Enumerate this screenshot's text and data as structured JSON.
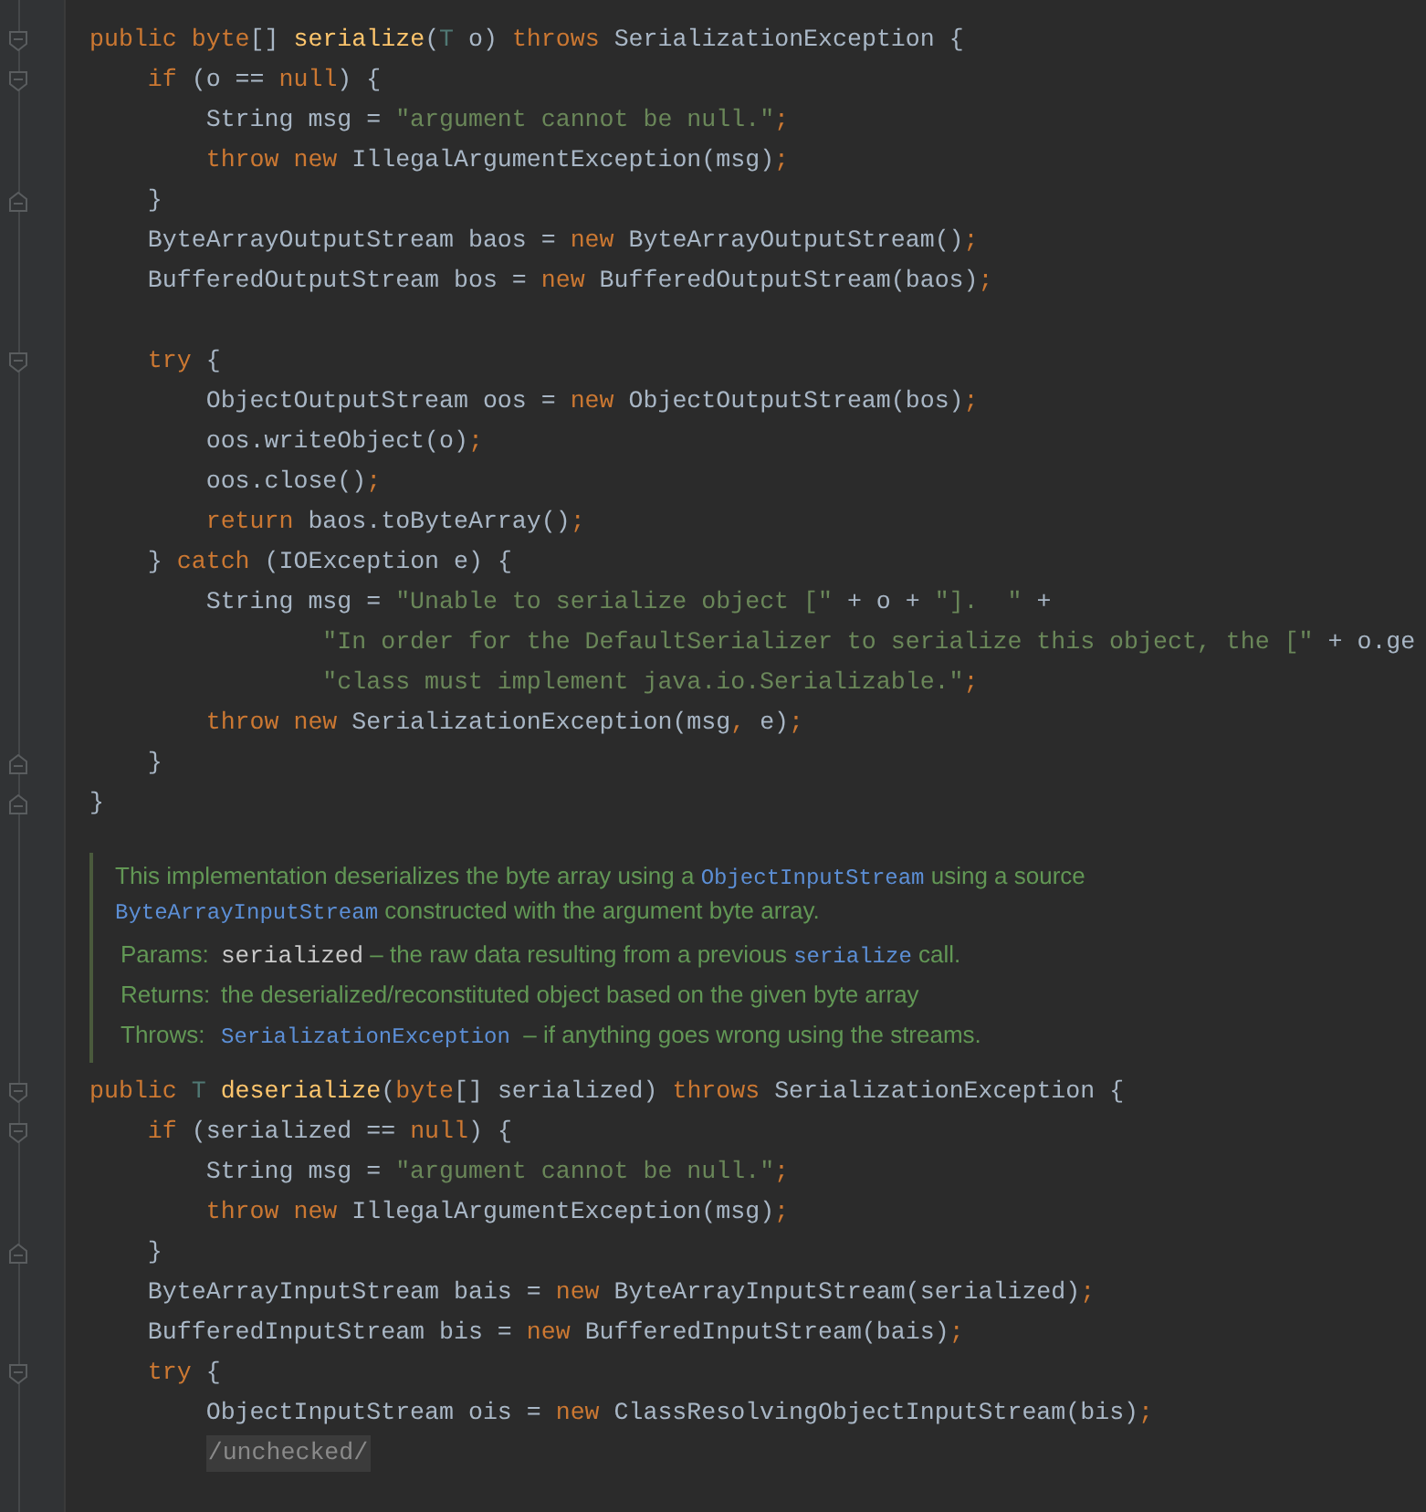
{
  "code_top": [
    {
      "kind": "fold-start",
      "tokens": [
        {
          "color": "#cc7832",
          "t": "public byte"
        },
        {
          "color": "#a9b7c6",
          "t": "[] "
        },
        {
          "color": "#ffc66d",
          "t": "serialize"
        },
        {
          "color": "#a9b7c6",
          "t": "("
        },
        {
          "color": "#507874",
          "t": "T"
        },
        {
          "color": "#a9b7c6",
          "t": " o) "
        },
        {
          "color": "#cc7832",
          "t": "throws "
        },
        {
          "color": "#a9b7c6",
          "t": "SerializationException {"
        }
      ]
    },
    {
      "kind": "fold-start",
      "tokens": [
        {
          "color": "#cc7832",
          "t": "    if "
        },
        {
          "color": "#a9b7c6",
          "t": "(o == "
        },
        {
          "color": "#cc7832",
          "t": "null"
        },
        {
          "color": "#a9b7c6",
          "t": ") {"
        }
      ]
    },
    {
      "kind": "plain",
      "tokens": [
        {
          "color": "#a9b7c6",
          "t": "        String msg = "
        },
        {
          "color": "#6a8759",
          "t": "\"argument cannot be null.\""
        },
        {
          "color": "#cc7832",
          "t": ";"
        }
      ]
    },
    {
      "kind": "plain",
      "tokens": [
        {
          "color": "#cc7832",
          "t": "        throw new "
        },
        {
          "color": "#a9b7c6",
          "t": "IllegalArgumentException(msg)"
        },
        {
          "color": "#cc7832",
          "t": ";"
        }
      ]
    },
    {
      "kind": "fold-end",
      "tokens": [
        {
          "color": "#a9b7c6",
          "t": "    }"
        }
      ]
    },
    {
      "kind": "plain",
      "tokens": [
        {
          "color": "#a9b7c6",
          "t": "    ByteArrayOutputStream baos = "
        },
        {
          "color": "#cc7832",
          "t": "new "
        },
        {
          "color": "#a9b7c6",
          "t": "ByteArrayOutputStream()"
        },
        {
          "color": "#cc7832",
          "t": ";"
        }
      ]
    },
    {
      "kind": "plain",
      "tokens": [
        {
          "color": "#a9b7c6",
          "t": "    BufferedOutputStream bos = "
        },
        {
          "color": "#cc7832",
          "t": "new "
        },
        {
          "color": "#a9b7c6",
          "t": "BufferedOutputStream(baos)"
        },
        {
          "color": "#cc7832",
          "t": ";"
        }
      ]
    },
    {
      "kind": "blank"
    },
    {
      "kind": "fold-start",
      "tokens": [
        {
          "color": "#cc7832",
          "t": "    try "
        },
        {
          "color": "#a9b7c6",
          "t": "{"
        }
      ]
    },
    {
      "kind": "plain",
      "tokens": [
        {
          "color": "#a9b7c6",
          "t": "        ObjectOutputStream oos = "
        },
        {
          "color": "#cc7832",
          "t": "new "
        },
        {
          "color": "#a9b7c6",
          "t": "ObjectOutputStream(bos)"
        },
        {
          "color": "#cc7832",
          "t": ";"
        }
      ]
    },
    {
      "kind": "plain",
      "tokens": [
        {
          "color": "#a9b7c6",
          "t": "        oos.writeObject(o)"
        },
        {
          "color": "#cc7832",
          "t": ";"
        }
      ]
    },
    {
      "kind": "plain",
      "tokens": [
        {
          "color": "#a9b7c6",
          "t": "        oos.close()"
        },
        {
          "color": "#cc7832",
          "t": ";"
        }
      ]
    },
    {
      "kind": "plain",
      "tokens": [
        {
          "color": "#cc7832",
          "t": "        return "
        },
        {
          "color": "#a9b7c6",
          "t": "baos.toByteArray()"
        },
        {
          "color": "#cc7832",
          "t": ";"
        }
      ]
    },
    {
      "kind": "plain",
      "tokens": [
        {
          "color": "#a9b7c6",
          "t": "    } "
        },
        {
          "color": "#cc7832",
          "t": "catch "
        },
        {
          "color": "#a9b7c6",
          "t": "(IOException e) {"
        }
      ]
    },
    {
      "kind": "plain",
      "tokens": [
        {
          "color": "#a9b7c6",
          "t": "        String msg = "
        },
        {
          "color": "#6a8759",
          "t": "\"Unable to serialize object [\" "
        },
        {
          "color": "#a9b7c6",
          "t": "+ o + "
        },
        {
          "color": "#6a8759",
          "t": "\"].  \" "
        },
        {
          "color": "#a9b7c6",
          "t": "+"
        }
      ]
    },
    {
      "kind": "plain",
      "tokens": [
        {
          "color": "#6a8759",
          "t": "                \"In order for the DefaultSerializer to serialize this object, the [\" "
        },
        {
          "color": "#a9b7c6",
          "t": "+ o.ge"
        }
      ]
    },
    {
      "kind": "plain",
      "tokens": [
        {
          "color": "#6a8759",
          "t": "                \"class must implement java.io.Serializable.\""
        },
        {
          "color": "#cc7832",
          "t": ";"
        }
      ]
    },
    {
      "kind": "plain",
      "tokens": [
        {
          "color": "#cc7832",
          "t": "        throw new "
        },
        {
          "color": "#a9b7c6",
          "t": "SerializationException(msg"
        },
        {
          "color": "#cc7832",
          "t": ", "
        },
        {
          "color": "#a9b7c6",
          "t": "e)"
        },
        {
          "color": "#cc7832",
          "t": ";"
        }
      ]
    },
    {
      "kind": "fold-end",
      "tokens": [
        {
          "color": "#a9b7c6",
          "t": "    }"
        }
      ]
    },
    {
      "kind": "fold-end",
      "tokens": [
        {
          "color": "#a9b7c6",
          "t": "}"
        }
      ]
    }
  ],
  "doc": {
    "paragraph": [
      {
        "kind": "text",
        "t": "This implementation deserializes the byte array using a "
      },
      {
        "kind": "code",
        "t": "ObjectInputStream"
      },
      {
        "kind": "text",
        "t": " using a source "
      },
      {
        "kind": "code",
        "t": "ByteArrayInputStream"
      },
      {
        "kind": "text",
        "t": " constructed with the argument byte array."
      }
    ],
    "tags": [
      {
        "label": "Params:",
        "parts": [
          {
            "kind": "param",
            "t": "serialized"
          },
          {
            "kind": "text",
            "t": " – the raw data resulting from a previous "
          },
          {
            "kind": "code",
            "t": "serialize"
          },
          {
            "kind": "text",
            "t": " call."
          }
        ]
      },
      {
        "label": "Returns:",
        "parts": [
          {
            "kind": "text",
            "t": "the deserialized/reconstituted object based on the given byte array"
          }
        ]
      },
      {
        "label": "Throws:",
        "parts": [
          {
            "kind": "code",
            "t": "SerializationException"
          },
          {
            "kind": "text",
            "t": "  – if anything goes wrong using the streams."
          }
        ]
      }
    ]
  },
  "code_bottom": [
    {
      "kind": "fold-start",
      "tokens": [
        {
          "color": "#cc7832",
          "t": "public "
        },
        {
          "color": "#507874",
          "t": "T "
        },
        {
          "color": "#ffc66d",
          "t": "deserialize"
        },
        {
          "color": "#a9b7c6",
          "t": "("
        },
        {
          "color": "#cc7832",
          "t": "byte"
        },
        {
          "color": "#a9b7c6",
          "t": "[] serialized) "
        },
        {
          "color": "#cc7832",
          "t": "throws "
        },
        {
          "color": "#a9b7c6",
          "t": "SerializationException {"
        }
      ]
    },
    {
      "kind": "fold-start",
      "tokens": [
        {
          "color": "#cc7832",
          "t": "    if "
        },
        {
          "color": "#a9b7c6",
          "t": "(serialized == "
        },
        {
          "color": "#cc7832",
          "t": "null"
        },
        {
          "color": "#a9b7c6",
          "t": ") {"
        }
      ]
    },
    {
      "kind": "plain",
      "tokens": [
        {
          "color": "#a9b7c6",
          "t": "        String msg = "
        },
        {
          "color": "#6a8759",
          "t": "\"argument cannot be null.\""
        },
        {
          "color": "#cc7832",
          "t": ";"
        }
      ]
    },
    {
      "kind": "plain",
      "tokens": [
        {
          "color": "#cc7832",
          "t": "        throw new "
        },
        {
          "color": "#a9b7c6",
          "t": "IllegalArgumentException(msg)"
        },
        {
          "color": "#cc7832",
          "t": ";"
        }
      ]
    },
    {
      "kind": "fold-end",
      "tokens": [
        {
          "color": "#a9b7c6",
          "t": "    }"
        }
      ]
    },
    {
      "kind": "plain",
      "tokens": [
        {
          "color": "#a9b7c6",
          "t": "    ByteArrayInputStream bais = "
        },
        {
          "color": "#cc7832",
          "t": "new "
        },
        {
          "color": "#a9b7c6",
          "t": "ByteArrayInputStream(serialized)"
        },
        {
          "color": "#cc7832",
          "t": ";"
        }
      ]
    },
    {
      "kind": "plain",
      "tokens": [
        {
          "color": "#a9b7c6",
          "t": "    BufferedInputStream bis = "
        },
        {
          "color": "#cc7832",
          "t": "new "
        },
        {
          "color": "#a9b7c6",
          "t": "BufferedInputStream(bais)"
        },
        {
          "color": "#cc7832",
          "t": ";"
        }
      ]
    },
    {
      "kind": "fold-start",
      "tokens": [
        {
          "color": "#cc7832",
          "t": "    try "
        },
        {
          "color": "#a9b7c6",
          "t": "{"
        }
      ]
    },
    {
      "kind": "plain",
      "tokens": [
        {
          "color": "#a9b7c6",
          "t": "        ObjectInputStream ois = "
        },
        {
          "color": "#cc7832",
          "t": "new "
        },
        {
          "color": "#a9b7c6",
          "t": "ClassResolvingObjectInputStream(bis)"
        },
        {
          "color": "#cc7832",
          "t": ";"
        }
      ]
    },
    {
      "kind": "folded",
      "text": "/unchecked/"
    }
  ]
}
